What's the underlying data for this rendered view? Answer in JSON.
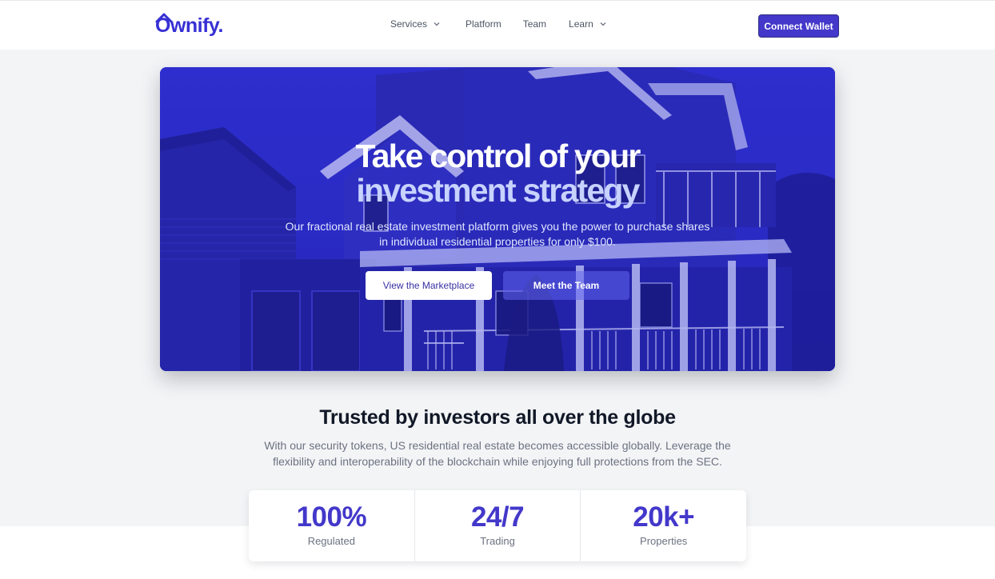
{
  "brand": {
    "name": "Ownify.",
    "color": "#3730d4"
  },
  "nav": {
    "links": [
      {
        "label": "Services",
        "dropdown": true
      },
      {
        "label": "Platform",
        "dropdown": false
      },
      {
        "label": "Team",
        "dropdown": false
      },
      {
        "label": "Learn",
        "dropdown": true
      }
    ],
    "cta": "Connect Wallet"
  },
  "hero": {
    "title_line1": "Take control of your",
    "title_line2": "investment strategy",
    "subtitle": "Our fractional real estate investment platform gives you the power to purchase shares in individual residential properties for only $100.",
    "primary_button": "View the Marketplace",
    "secondary_button": "Meet the Team",
    "overlay_color": "#2b2ac8"
  },
  "trust": {
    "title": "Trusted by investors all over the globe",
    "subtitle": "With our security tokens, US residential real estate becomes accessible globally. Leverage the flexibility and interoperability of the blockchain while enjoying full protections from the SEC."
  },
  "stats": [
    {
      "value": "100%",
      "label": "Regulated"
    },
    {
      "value": "24/7",
      "label": "Trading"
    },
    {
      "value": "20k+",
      "label": "Properties"
    }
  ]
}
